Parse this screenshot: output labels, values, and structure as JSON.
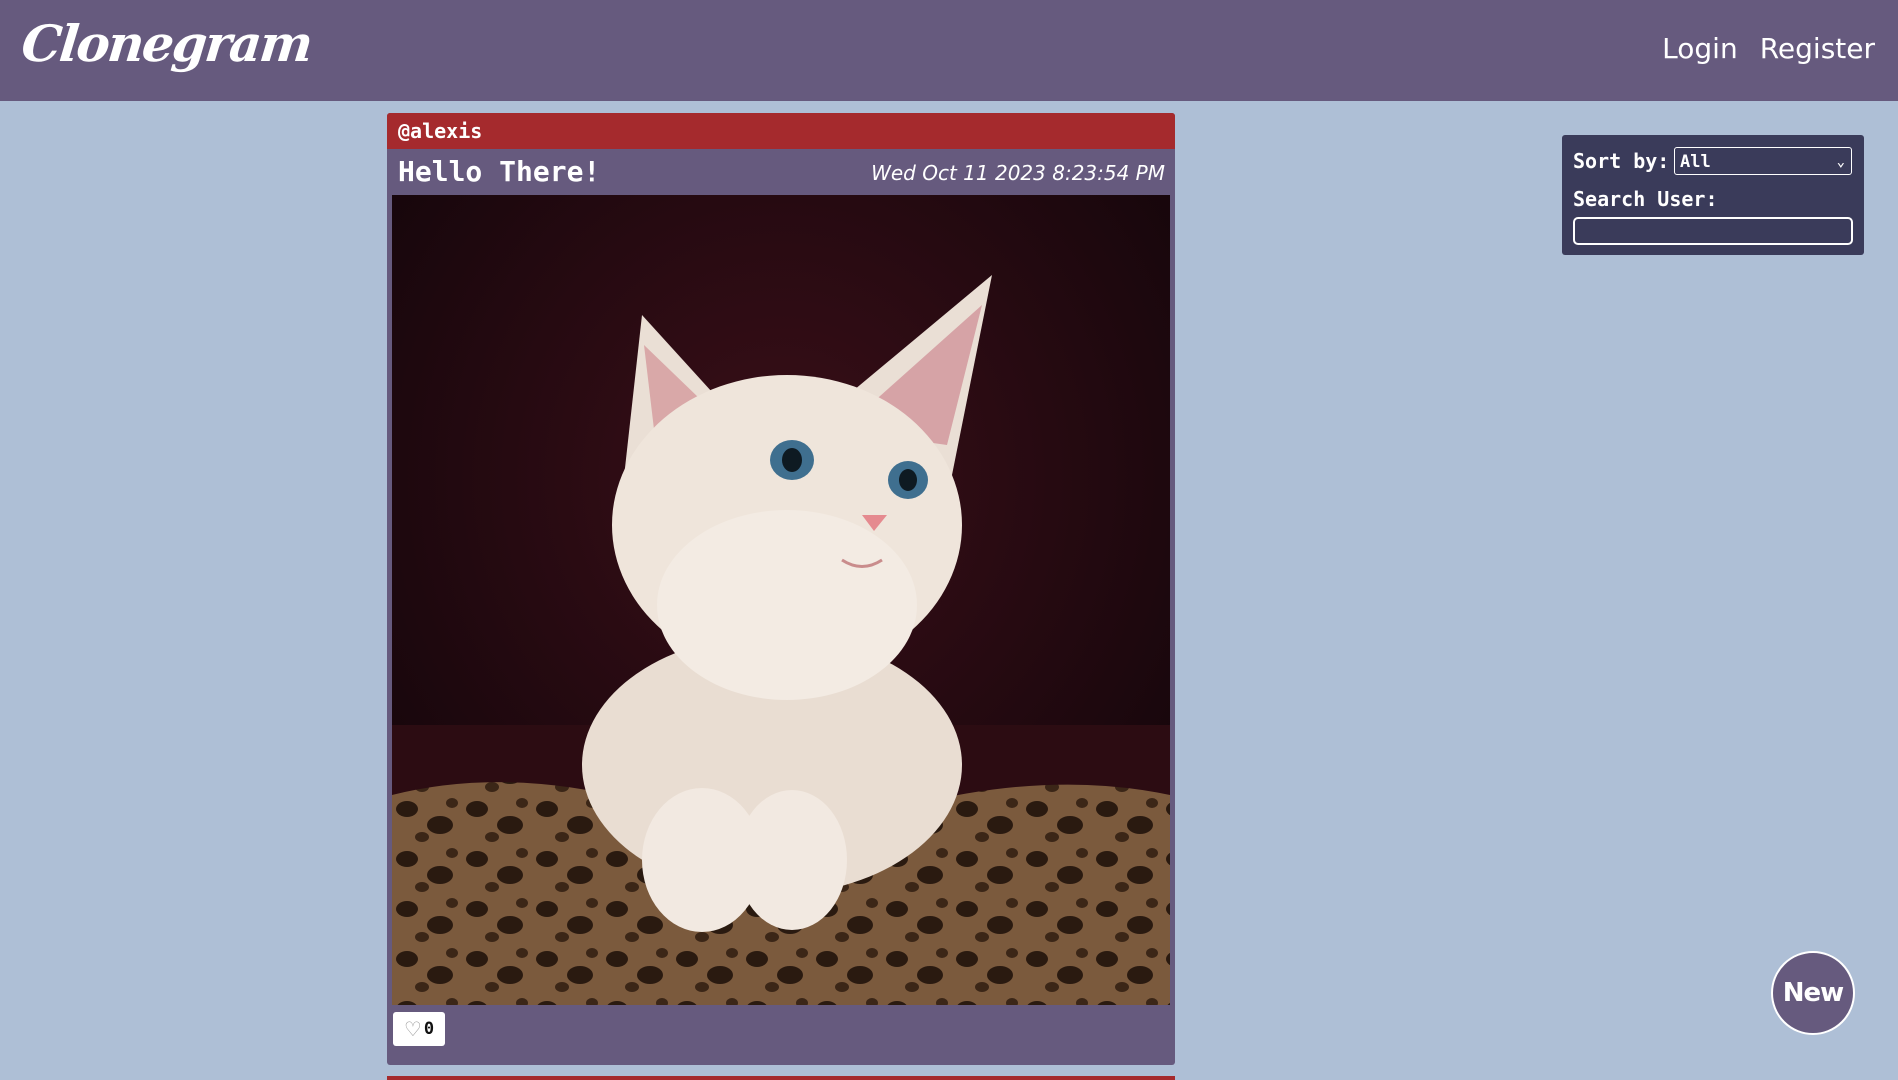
{
  "app": {
    "brand": "Clonegram"
  },
  "nav": {
    "login": "Login",
    "register": "Register"
  },
  "post": {
    "username": "@alexis",
    "title": "Hello There!",
    "date": "Wed Oct 11 2023 8:23:54 PM",
    "likes": "0",
    "image_alt": "kitten photo"
  },
  "filters": {
    "sort_label": "Sort by:",
    "sort_value": "All",
    "search_label": "Search User:",
    "search_value": ""
  },
  "fab": {
    "label": "New"
  },
  "icons": {
    "like": "heart-outline-icon",
    "dropdown": "chevron-down-icon"
  },
  "colors": {
    "background": "#aebfd6",
    "navbar": "#665a7e",
    "post_header": "#a52a2d",
    "panel": "#3a3b5a"
  }
}
